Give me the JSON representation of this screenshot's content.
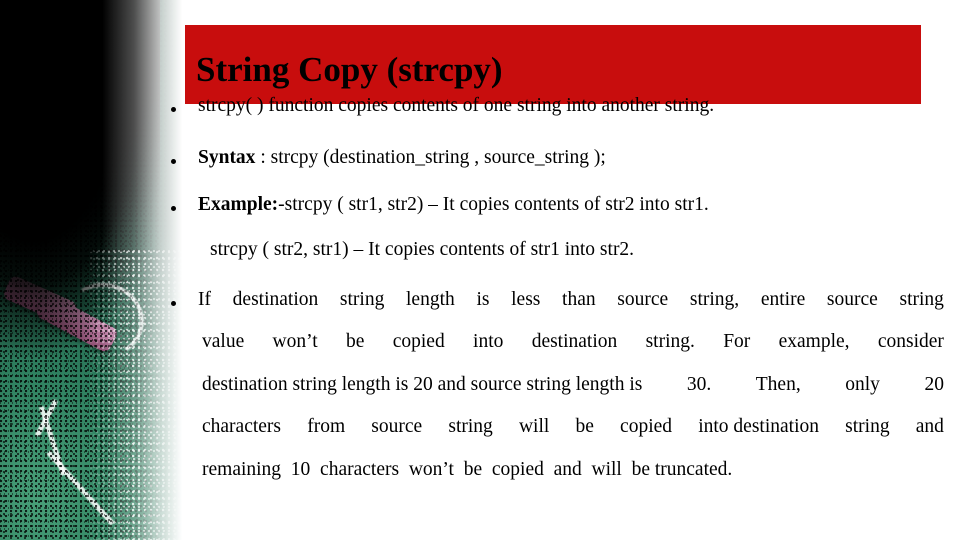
{
  "slide": {
    "title": "String Copy (strcpy)",
    "title_banner_color": "#c80d0d",
    "background_color": "#ffffff",
    "text_color": "#000000"
  },
  "decoration": {
    "name": "chalkboard-photo",
    "board_color": "#2f8160",
    "chalk_color": "#c37fa8",
    "dark_color": "#000000",
    "chalk_stroke_color": "#ffffff"
  },
  "content": {
    "bullet_1": {
      "text": "strcpy( ) function copies contents of one string into another string."
    },
    "bullet_2": {
      "label": "Syntax",
      "rest": " : strcpy (destination_string , source_string );"
    },
    "bullet_3": {
      "label": "Example:",
      "rest": "-strcpy ( str1, str2) – It copies contents of str2 into str1."
    },
    "sub_line": {
      "text": "strcpy ( str2, str1) – It copies contents of str1 into str2."
    },
    "paragraph": {
      "line_1": [
        "If",
        "destination",
        "string",
        "length",
        "is",
        "less",
        "than",
        "source",
        "string,",
        "entire",
        "source",
        "string"
      ],
      "line_2": [
        "value",
        "won’t",
        "be",
        "copied",
        "into",
        "destination",
        "string.",
        "For",
        "example,",
        "consider"
      ],
      "line_3": [
        "destination string length is 20 and source string length is",
        "30.",
        "Then,",
        "only",
        "20"
      ],
      "line_4": [
        "characters",
        "from",
        "source",
        "string",
        "will",
        "be",
        "copied",
        "into destination",
        "string",
        "and"
      ],
      "line_5": "remaining  10  characters  won’t  be  copied  and  will  be truncated."
    }
  }
}
